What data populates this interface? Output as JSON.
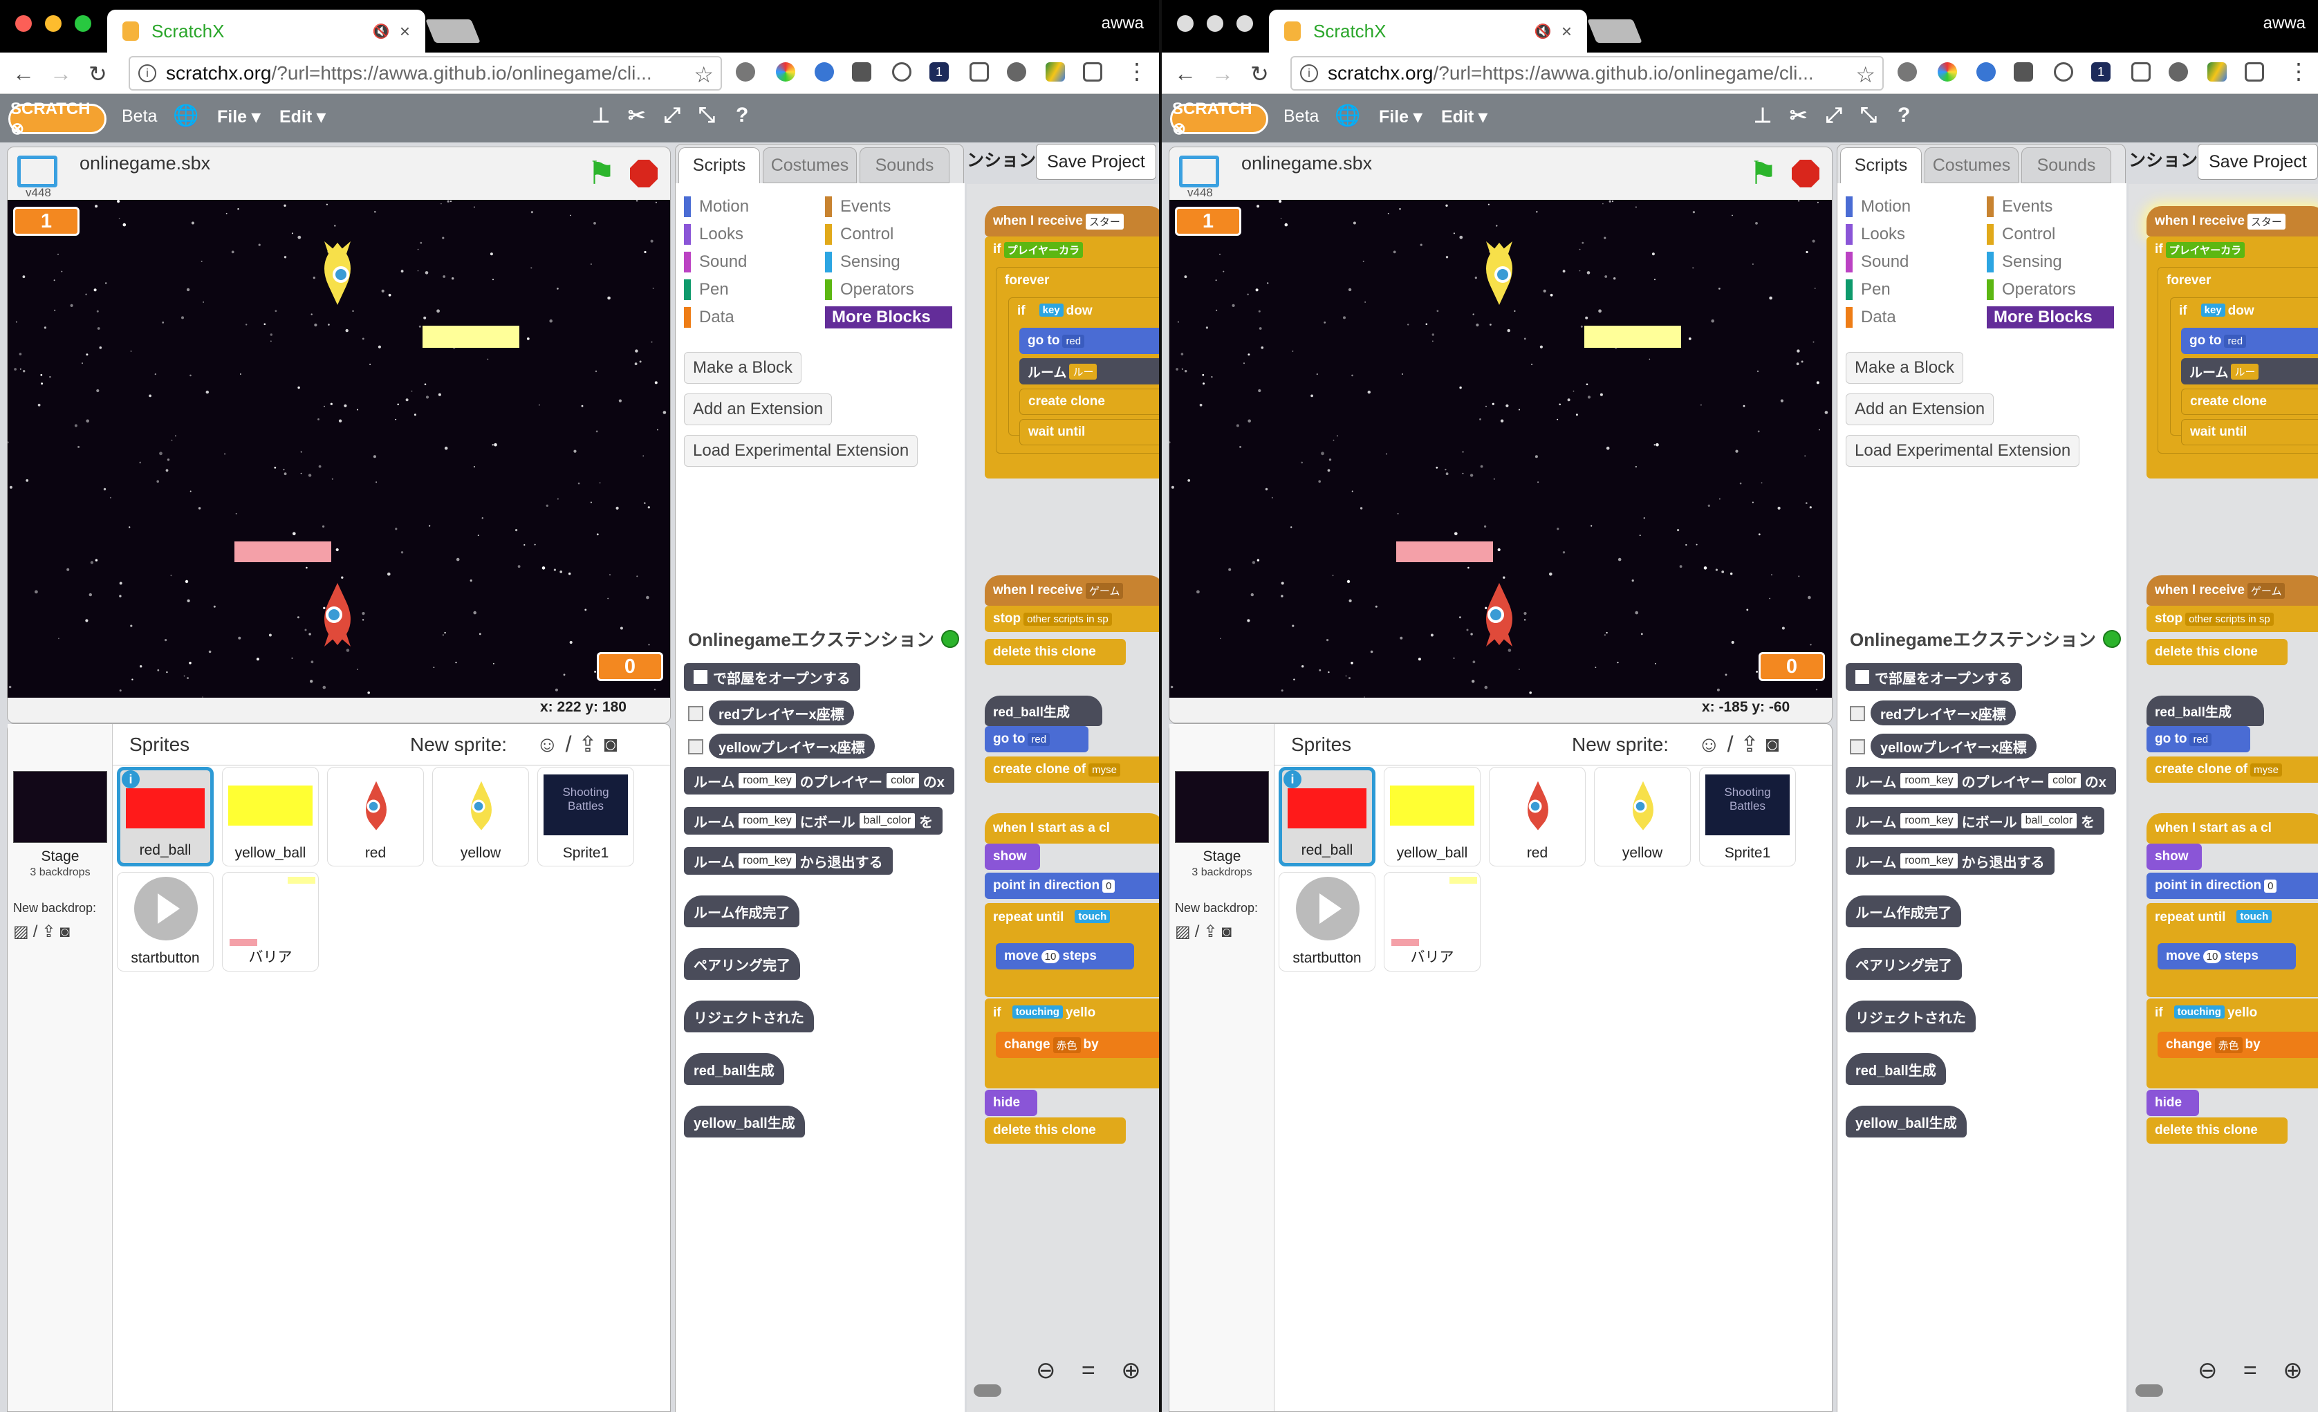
{
  "windows": [
    {
      "id": "left",
      "tab_title": "ScratchX",
      "user": "awwa",
      "url_domain": "scratchx.org",
      "url_rest": "/?url=https://awwa.github.io/onlinegame/cli...",
      "menu": {
        "beta": "Beta",
        "file": "File ▾",
        "edit": "Edit ▾"
      },
      "project_name": "onlinegame.sbx",
      "version": "v448",
      "counter_top": "1",
      "counter_bottom": "0",
      "coords": "x:  222   y:  180",
      "sprites_title": "Sprites",
      "new_sprite": "New sprite:",
      "stage_label": "Stage",
      "stage_backdrops": "3 backdrops",
      "new_backdrop": "New backdrop:",
      "sprites": [
        "red_ball",
        "yellow_ball",
        "red",
        "yellow",
        "Sprite1",
        "startbutton",
        "バリア"
      ],
      "shooting_thumb": "Shooting Battles",
      "tabs": [
        "Scripts",
        "Costumes",
        "Sounds"
      ],
      "save": "Save Project",
      "jp_head": "ンション",
      "cats_left": [
        "Motion",
        "Looks",
        "Sound",
        "Pen",
        "Data"
      ],
      "cats_right": [
        "Events",
        "Control",
        "Sensing",
        "Operators",
        "More Blocks"
      ],
      "buttons": [
        "Make a Block",
        "Add an Extension",
        "Load Experimental Extension"
      ],
      "ext_title": "Onlinegameエクステンション",
      "blocks": {
        "b1": "で部屋をオープンする",
        "b2": "redプレイヤーx座標",
        "b3": "yellowプレイヤーx座標",
        "b4a": "ルーム",
        "b4s1": "room_key",
        "b4b": "のプレイヤー",
        "b4s2": "color",
        "b4c": "のx",
        "b5a": "ルーム",
        "b5s1": "room_key",
        "b5b": "にボール",
        "b5s2": "ball_color",
        "b5c": "を",
        "b6a": "ルーム",
        "b6s1": "room_key",
        "b6b": "から退出する",
        "b7": "ルーム作成完了",
        "b8": "ペアリング完了",
        "b9": "リジェクトされた",
        "b10": "red_ball生成",
        "b11": "yellow_ball生成"
      },
      "script": {
        "s1": "when I receive",
        "s1v": "スター",
        "s2": "if",
        "s2v": "プレイヤーカラ",
        "s3": "forever",
        "s4": "if",
        "s4v": "key",
        "s4w": "dow",
        "s5": "go to",
        "s5v": "red",
        "s6": "ルーム",
        "s6v": "ルー",
        "s7": "create clone",
        "s8": "wait until",
        "s9": "when I receive",
        "s9v": "ゲーム",
        "s10": "stop",
        "s10v": "other scripts in sp",
        "s11": "delete this clone",
        "s12": "red_ball生成",
        "s13": "go to",
        "s13v": "red",
        "s14": "create clone of",
        "s14v": "myse",
        "s15": "when I start as a cl",
        "s16": "show",
        "s17": "point in direction",
        "s17v": "0",
        "s18": "repeat until",
        "s18v": "touch",
        "s19": "move",
        "s19v": "10",
        "s19w": "steps",
        "s20": "if",
        "s20v": "touching",
        "s20w": "yello",
        "s21": "change",
        "s21v": "赤色",
        "s21w": "by",
        "s22": "hide",
        "s23": "delete this clone"
      },
      "zoom": "⊖ = ⊕"
    },
    {
      "id": "right",
      "tab_title": "ScratchX",
      "user": "awwa",
      "url_domain": "scratchx.org",
      "url_rest": "/?url=https://awwa.github.io/onlinegame/cli...",
      "menu": {
        "beta": "Beta",
        "file": "File ▾",
        "edit": "Edit ▾"
      },
      "project_name": "onlinegame.sbx",
      "version": "v448",
      "counter_top": "1",
      "counter_bottom": "0",
      "coords": "x:  -185   y:  -60",
      "sprites_title": "Sprites",
      "new_sprite": "New sprite:",
      "stage_label": "Stage",
      "stage_backdrops": "3 backdrops",
      "new_backdrop": "New backdrop:",
      "sprites": [
        "red_ball",
        "yellow_ball",
        "red",
        "yellow",
        "Sprite1",
        "startbutton",
        "バリア"
      ],
      "shooting_thumb": "Shooting Battles",
      "tabs": [
        "Scripts",
        "Costumes",
        "Sounds"
      ],
      "save": "Save Project",
      "jp_head": "ンション",
      "cats_left": [
        "Motion",
        "Looks",
        "Sound",
        "Pen",
        "Data"
      ],
      "cats_right": [
        "Events",
        "Control",
        "Sensing",
        "Operators",
        "More Blocks"
      ],
      "buttons": [
        "Make a Block",
        "Add an Extension",
        "Load Experimental Extension"
      ],
      "ext_title": "Onlinegameエクステンション",
      "blocks": {
        "b1": "で部屋をオープンする",
        "b2": "redプレイヤーx座標",
        "b3": "yellowプレイヤーx座標",
        "b4a": "ルーム",
        "b4s1": "room_key",
        "b4b": "のプレイヤー",
        "b4s2": "color",
        "b4c": "のx",
        "b5a": "ルーム",
        "b5s1": "room_key",
        "b5b": "にボール",
        "b5s2": "ball_color",
        "b5c": "を",
        "b6a": "ルーム",
        "b6s1": "room_key",
        "b6b": "から退出する",
        "b7": "ルーム作成完了",
        "b8": "ペアリング完了",
        "b9": "リジェクトされた",
        "b10": "red_ball生成",
        "b11": "yellow_ball生成"
      },
      "script": {
        "s1": "when I receive",
        "s1v": "スター",
        "s2": "if",
        "s2v": "プレイヤーカラ",
        "s3": "forever",
        "s4": "if",
        "s4v": "key",
        "s4w": "dow",
        "s5": "go to",
        "s5v": "red",
        "s6": "ルーム",
        "s6v": "ルー",
        "s7": "create clone",
        "s8": "wait until",
        "s9": "when I receive",
        "s9v": "ゲーム",
        "s10": "stop",
        "s10v": "other scripts in sp",
        "s11": "delete this clone",
        "s12": "red_ball生成",
        "s13": "go to",
        "s13v": "red",
        "s14": "create clone of",
        "s14v": "myse",
        "s15": "when I start as a cl",
        "s16": "show",
        "s17": "point in direction",
        "s17v": "0",
        "s18": "repeat until",
        "s18v": "touch",
        "s19": "move",
        "s19v": "10",
        "s19w": "steps",
        "s20": "if",
        "s20v": "touching",
        "s20w": "yello",
        "s21": "change",
        "s21v": "赤色",
        "s21w": "by",
        "s22": "hide",
        "s23": "delete this clone"
      },
      "zoom": "⊖ = ⊕"
    }
  ],
  "colors": {
    "events": "#c88330",
    "control": "#e1a91a",
    "motion": "#4a6cd4",
    "looks": "#8a55d7",
    "operators": "#5cb712",
    "more_blocks": "#632d99",
    "extension": "#4a4c5a",
    "red_ball": "#ff1a1a",
    "yellow_ball": "#ffff33"
  }
}
